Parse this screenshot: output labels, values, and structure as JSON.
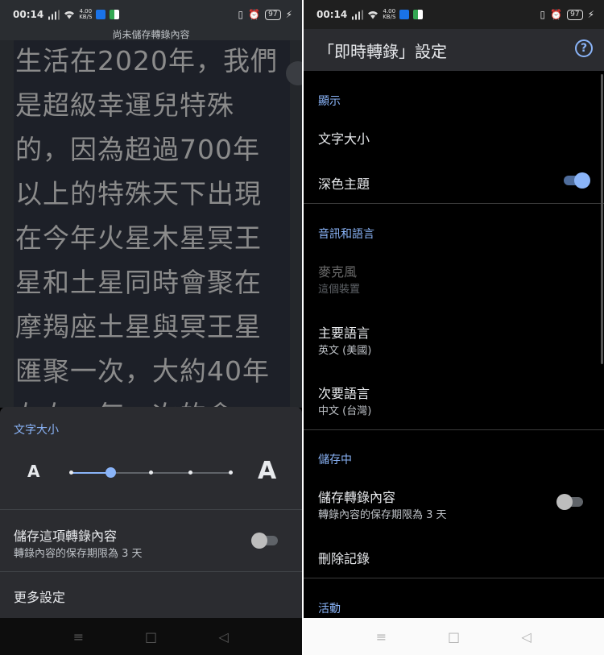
{
  "status_left": {
    "time": "00:14",
    "net_speed": "4.00",
    "net_unit": "KB/S",
    "battery": "97"
  },
  "status_right": {
    "time": "00:14",
    "net_speed": "4.00",
    "net_unit": "KB/S",
    "battery": "97"
  },
  "caption": {
    "header": "尚未儲存轉錄內容",
    "lines": [
      "生活在2020年，我們",
      "是超級幸運兒特殊",
      "的，因為超過700年",
      "以上的特殊天下出現",
      "在今年火星木星冥王",
      "星和土星同時會聚在",
      "摩羯座土星與冥王星",
      "匯聚一次，大約40年",
      "左右。每一次的會"
    ]
  },
  "sheet": {
    "title": "文字大小",
    "size_small": "A",
    "size_large": "A",
    "text_size_level": 0.25,
    "save_title": "儲存這項轉錄內容",
    "save_sub": "轉錄內容的保存期限為 3 天",
    "save_on": false,
    "more": "更多設定"
  },
  "settings": {
    "title": "「即時轉錄」設定",
    "help_icon": "help-circle-icon",
    "sections": {
      "display": "顯示",
      "audio": "音訊和語言",
      "storage": "儲存中",
      "activity": "活動"
    },
    "text_size": "文字大小",
    "dark_theme": "深色主題",
    "dark_theme_on": true,
    "mic_title": "麥克風",
    "mic_sub": "這個裝置",
    "primary_lang_title": "主要語言",
    "primary_lang_sub": "英文 (美國)",
    "secondary_lang_title": "次要語言",
    "secondary_lang_sub": "中文 (台灣)",
    "save_title": "儲存轉錄內容",
    "save_sub": "轉錄內容的保存期限為 3 天",
    "save_on": false,
    "delete": "刪除記錄"
  },
  "nav": {
    "menu_icon": "≡",
    "home_icon": "□",
    "back_icon": "◁"
  },
  "colors": {
    "accent": "#8ab4f8",
    "background": "#000000",
    "sheet": "#2b2c30"
  }
}
